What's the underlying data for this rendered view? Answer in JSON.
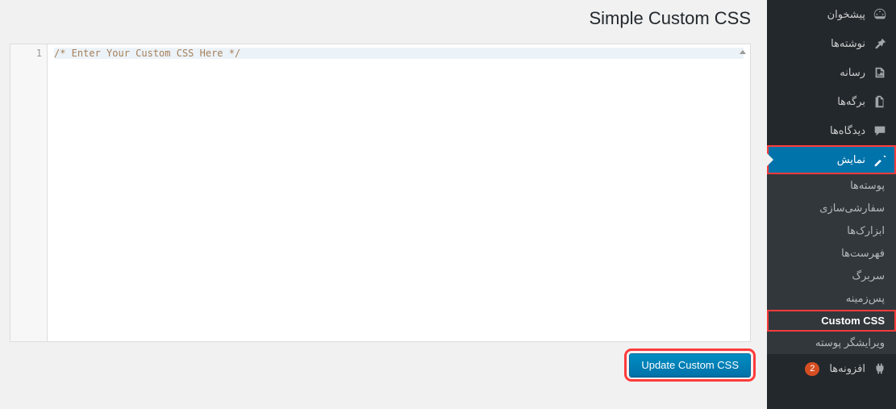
{
  "page": {
    "title": "Simple Custom CSS"
  },
  "sidebar": {
    "items": [
      {
        "label": "پیشخوان",
        "icon": "dashboard"
      },
      {
        "label": "نوشته‌ها",
        "icon": "pin"
      },
      {
        "label": "رسانه",
        "icon": "media"
      },
      {
        "label": "برگه‌ها",
        "icon": "pages"
      },
      {
        "label": "دیدگاه‌ها",
        "icon": "comments"
      },
      {
        "label": "نمایش",
        "icon": "appearance"
      },
      {
        "label": "افزونه‌ها",
        "icon": "plugins"
      }
    ],
    "plugins_badge": "2",
    "submenu": [
      {
        "label": "پوسته‌ها"
      },
      {
        "label": "سفارشی‌سازی"
      },
      {
        "label": "ابزارک‌ها"
      },
      {
        "label": "فهرست‌ها"
      },
      {
        "label": "سربرگ"
      },
      {
        "label": "پس‌زمینه"
      },
      {
        "label": "Custom CSS"
      },
      {
        "label": "ویرایشگر پوسته"
      }
    ]
  },
  "editor": {
    "line_number": "1",
    "code": "/* Enter Your Custom CSS Here */"
  },
  "button": {
    "update": "Update Custom CSS"
  }
}
